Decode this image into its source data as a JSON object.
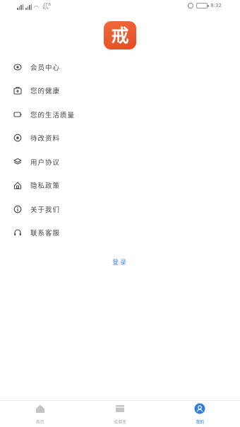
{
  "status_bar": {
    "net_speed": "27.6\nK/s",
    "clock": "8:32"
  },
  "logo": {
    "char": "戒"
  },
  "menu": [
    {
      "label": "会员中心",
      "icon": "eye-icon"
    },
    {
      "label": "您的健康",
      "icon": "health-icon"
    },
    {
      "label": "您的生活质量",
      "icon": "battery-icon"
    },
    {
      "label": "待改资料",
      "icon": "record-icon"
    },
    {
      "label": "用户协议",
      "icon": "layers-icon"
    },
    {
      "label": "隐私政策",
      "icon": "shield-icon"
    },
    {
      "label": "关于我们",
      "icon": "info-icon"
    },
    {
      "label": "联系客服",
      "icon": "headset-icon"
    }
  ],
  "login_label": "登录",
  "tabs": [
    {
      "label": "首页",
      "icon": "home-icon",
      "active": false
    },
    {
      "label": "戒烟室",
      "icon": "folder-icon",
      "active": false
    },
    {
      "label": "我的",
      "icon": "user-icon",
      "active": true
    }
  ],
  "colors": {
    "accent": "#2f7ddc",
    "logo": "#e9582d"
  }
}
